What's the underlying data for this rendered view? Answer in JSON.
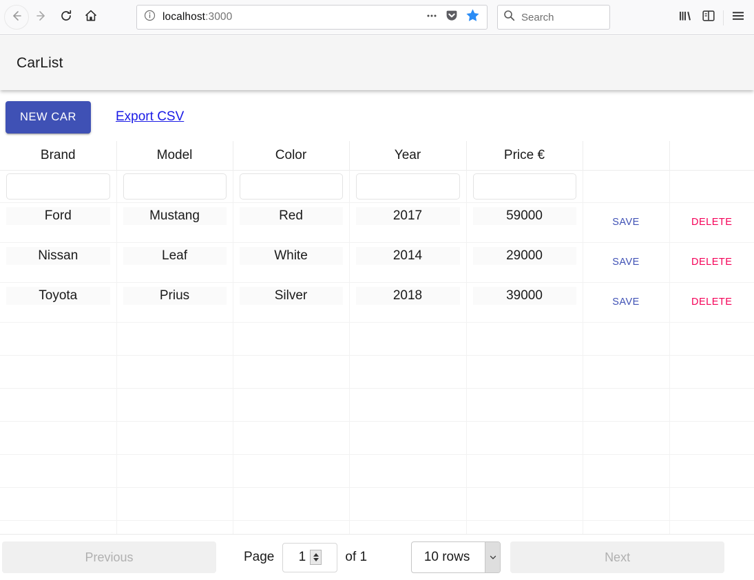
{
  "browser": {
    "url_host": "localhost",
    "url_port": ":3000",
    "search_placeholder": "Search",
    "icons": {
      "back": "back-arrow-icon",
      "forward": "forward-arrow-icon",
      "reload": "reload-icon",
      "home": "home-icon",
      "identity": "info-circle-icon",
      "page_actions": "ellipsis-icon",
      "pocket": "pocket-icon",
      "bookmark": "star-icon",
      "search": "search-icon",
      "library": "library-icon",
      "sidebar": "sidebar-icon",
      "menu": "hamburger-menu-icon"
    },
    "colors": {
      "bookmark_star": "#2b8cf5",
      "chrome_bg": "#f9f9fa"
    }
  },
  "appbar": {
    "title": "CarList",
    "bg": "#f5f5f5"
  },
  "toolbar": {
    "new_car_label": "NEW CAR",
    "export_label": "Export CSV",
    "new_car_color": "#3f51b5",
    "export_color": "#1a1ae6"
  },
  "table": {
    "columns": [
      "Brand",
      "Model",
      "Color",
      "Year",
      "Price €",
      "",
      ""
    ],
    "filters": [
      "",
      "",
      "",
      "",
      ""
    ],
    "filter_placeholder": "",
    "save_label": "SAVE",
    "delete_label": "DELETE",
    "save_color": "#3f51b5",
    "delete_color": "#f50057",
    "rows": [
      {
        "brand": "Ford",
        "model": "Mustang",
        "color": "Red",
        "year": "2017",
        "price": "59000"
      },
      {
        "brand": "Nissan",
        "model": "Leaf",
        "color": "White",
        "year": "2014",
        "price": "29000"
      },
      {
        "brand": "Toyota",
        "model": "Prius",
        "color": "Silver",
        "year": "2018",
        "price": "39000"
      }
    ],
    "empty_row_count": 7
  },
  "pagination": {
    "previous_label": "Previous",
    "next_label": "Next",
    "page_label": "Page",
    "page_value": "1",
    "of_label": "of 1",
    "rows_per_page": "10 rows",
    "previous_disabled": true,
    "next_disabled": true
  }
}
